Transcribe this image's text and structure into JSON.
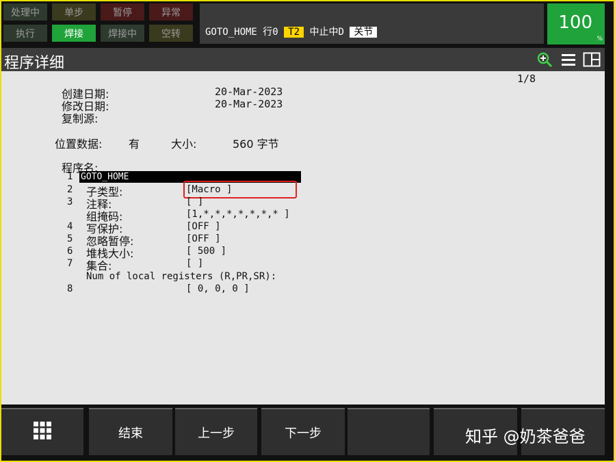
{
  "status_lamps": [
    {
      "label": "处理中",
      "bg": "#2e3a2e",
      "fg": "#9a9a9a"
    },
    {
      "label": "单步",
      "bg": "#3a3a1e",
      "fg": "#9a9a9a"
    },
    {
      "label": "暂停",
      "bg": "#4a1a1a",
      "fg": "#9a9a9a"
    },
    {
      "label": "异常",
      "bg": "#4a1a1a",
      "fg": "#9a9a9a"
    },
    {
      "label": "执行",
      "bg": "#2e3a2e",
      "fg": "#9a9a9a"
    },
    {
      "label": "焊接",
      "bg": "#1fa33a",
      "fg": "#ffffff"
    },
    {
      "label": "焊接中",
      "bg": "#2e3a2e",
      "fg": "#9a9a9a"
    },
    {
      "label": "空转",
      "bg": "#3a3a1e",
      "fg": "#9a9a9a"
    }
  ],
  "header": {
    "program": "GOTO_HOME",
    "line": "行0",
    "mode": "T2",
    "state": "中止中D",
    "joint": "关节"
  },
  "override": {
    "value": "100",
    "unit": "%"
  },
  "titlebar": {
    "title": "程序详细"
  },
  "detail": {
    "page": "1/8",
    "created_label": "创建日期:",
    "created_value": "20-Mar-2023",
    "modified_label": "修改日期:",
    "modified_value": "20-Mar-2023",
    "copy_label": "复制源:",
    "position_label": "位置数据:",
    "position_value": "有",
    "size_label": "大小:",
    "size_value": "560 字节",
    "program_name_label": "程序名:",
    "items": [
      {
        "num": "1",
        "label": "GOTO_HOME",
        "value": ""
      },
      {
        "num": "2",
        "label": "子类型:",
        "value": "[Macro            ]"
      },
      {
        "num": "3",
        "label": "注释:",
        "value": "[                        ]"
      },
      {
        "num": "",
        "label": "组掩码:",
        "value": "[1,*,*,*,*,*,*,* ]"
      },
      {
        "num": "4",
        "label": "写保护:",
        "value": "[OFF                     ]"
      },
      {
        "num": "5",
        "label": "忽略暂停:",
        "value": "[OFF                     ]"
      },
      {
        "num": "6",
        "label": "堆栈大小:",
        "value": "[      500               ]"
      },
      {
        "num": "7",
        "label": "集合:",
        "value": "[                        ]"
      },
      {
        "num": "",
        "label": "Num of local registers (R,PR,SR):",
        "value": ""
      },
      {
        "num": "8",
        "label": "",
        "value": "[  0,   0,   0      ]"
      }
    ]
  },
  "fkeys": [
    {
      "label": "",
      "icon": "grid-menu-icon"
    },
    {
      "label": "结束"
    },
    {
      "label": "上一步"
    },
    {
      "label": "下一步"
    },
    {
      "label": ""
    },
    {
      "label": ""
    },
    {
      "label": ""
    }
  ],
  "watermark": "知乎 @奶茶爸爸",
  "highlight_color": "#e02020"
}
